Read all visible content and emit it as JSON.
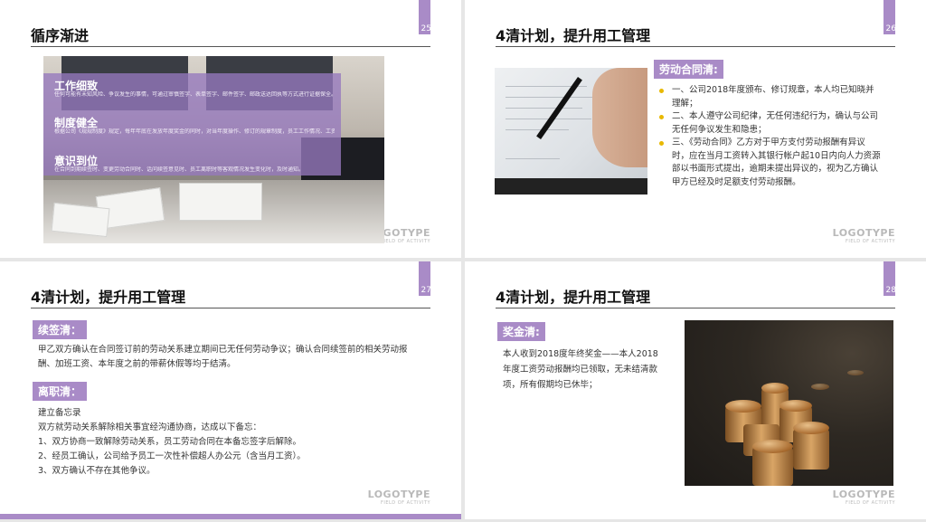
{
  "logo": {
    "name": "LOGOTYPE",
    "sub": "FIELD OF ACTIVITY"
  },
  "slides": [
    {
      "title": "循序渐进",
      "number": "25",
      "overlay": [
        {
          "heading": "工作细致",
          "text": "任何可能有未知风险、争议发生的事情，可通过审慎签字、表单签字、邮件签字、邮政送达回执等方式进行证据保全。"
        },
        {
          "heading": "制度健全",
          "text": "根据公司《规规制度》规定，每年年底在发放年度奖金的同时，对当年度操作、修订的规章制度，员工工作情况、工资发放、加班休假等情况进行确认。"
        },
        {
          "heading": "意识到位",
          "text": "在合同到期续签时、变更劳动合同时、话问续签意见时、员工离职时等客观情况发生变化时，及时通知。"
        }
      ]
    },
    {
      "title": "4清计划，提升用工管理",
      "number": "26",
      "label": "劳动合同清:",
      "items": [
        "一、公司2018年度颁布、修订规章，本人均已知晓并理解；",
        "二、本人遵守公司纪律，无任何违纪行为，确认与公司无任何争议发生和隐患；",
        "三、《劳动合同》乙方对于甲方支付劳动报酬有异议时，应在当月工资转入其银行帐户起10日内向人力资源部以书面形式提出，逾期未提出异议的，视为乙方确认甲方已经及时足额支付劳动报酬。"
      ]
    },
    {
      "title": "4清计划，提升用工管理",
      "number": "27",
      "label1": "续签清：",
      "text1": "甲乙双方确认在合同签订前的劳动关系建立期间已无任何劳动争议；确认合同续签前的相关劳动报酬、加班工资、本年度之前的带薪休假等均于结清。",
      "label2": "离职清：",
      "lines": [
        "建立备忘录",
        "双方就劳动关系解除相关事宜经沟通协商，达成以下备忘：",
        "1、双方协商一致解除劳动关系，员工劳动合同在本备忘签字后解除。",
        "2、经员工确认，公司给予员工一次性补偿超人办公元（含当月工资）。",
        "3、双方确认不存在其他争议。"
      ]
    },
    {
      "title": "4清计划，提升用工管理",
      "number": "28",
      "label": "奖金清:",
      "text": "本人收到2018度年终奖金——本人2018年度工资劳动报酬均已领取，无未结清款项，所有假期均已休毕；"
    }
  ]
}
